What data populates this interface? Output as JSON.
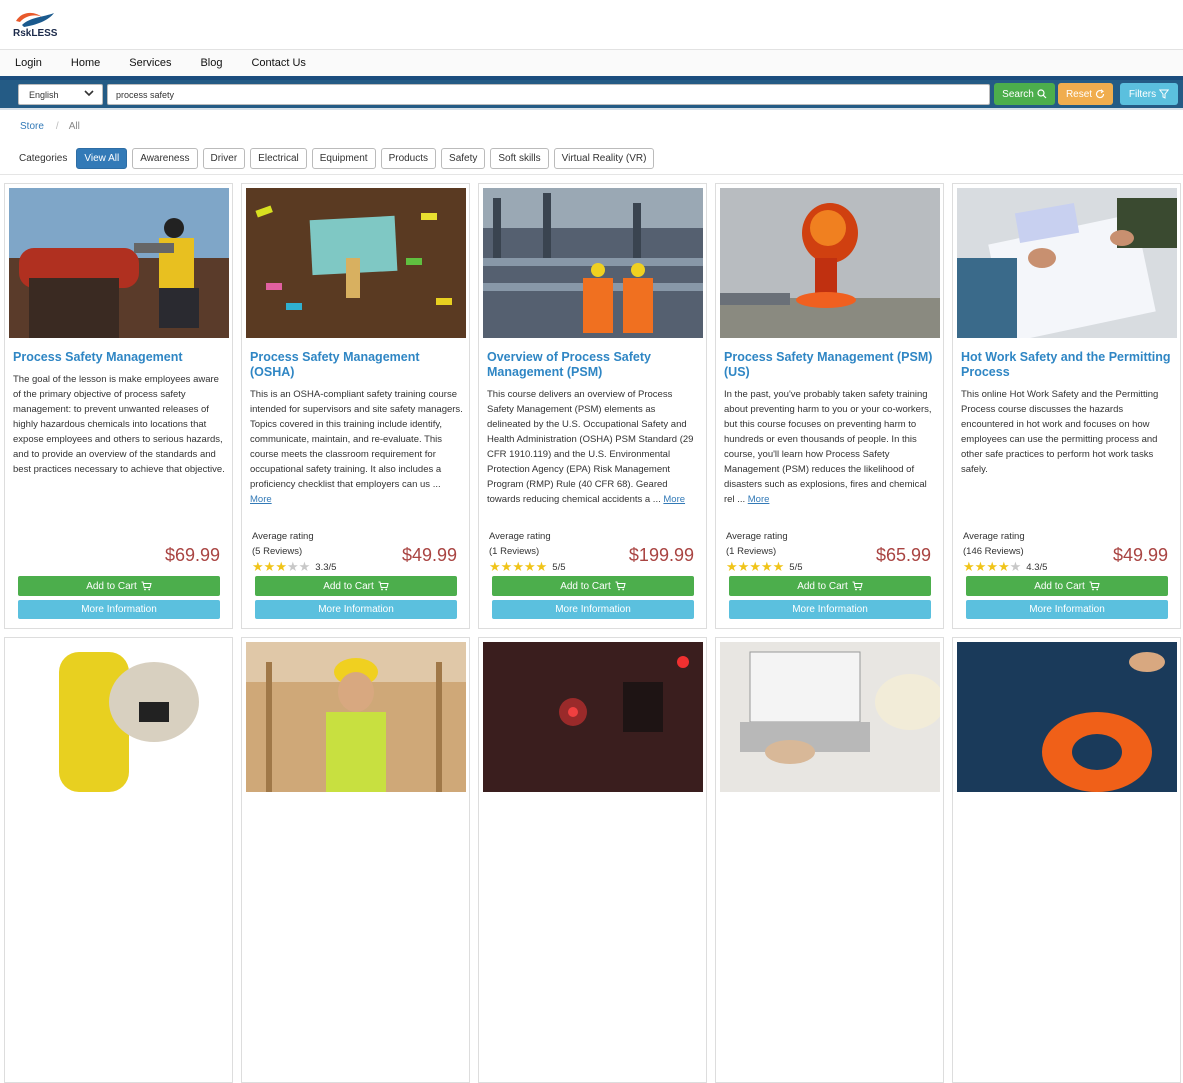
{
  "brand": {
    "name": "RskLESS"
  },
  "nav": [
    "Login",
    "Home",
    "Services",
    "Blog",
    "Contact Us"
  ],
  "search": {
    "language": "English",
    "query": "process safety",
    "search_label": "Search",
    "reset_label": "Reset",
    "filters_label": "Filters"
  },
  "breadcrumb": {
    "root": "Store",
    "current": "All"
  },
  "categories": {
    "label": "Categories",
    "items": [
      "View All",
      "Awareness",
      "Driver",
      "Electrical",
      "Equipment",
      "Products",
      "Safety",
      "Soft skills",
      "Virtual Reality (VR)"
    ],
    "active": "View All"
  },
  "labels": {
    "avg_rating": "Average rating",
    "add_to_cart": "Add to Cart",
    "more_info": "More Information",
    "more": "More"
  },
  "courses": [
    {
      "title": "Process Safety Management",
      "description": "The goal of the lesson is make employees aware of the primary objective of process safety management: to prevent unwanted releases of highly hazardous chemicals into locations that expose employees and others to serious hazards, and to provide an overview of the standards and best practices necessary to achieve that objective.",
      "price": "$69.99",
      "has_rating": false
    },
    {
      "title": "Process Safety Management (OSHA)",
      "description": "This is an OSHA-compliant safety training course intended for supervisors and site safety managers. Topics covered in this training include identify, communicate, maintain, and re-evaluate. This course meets the classroom requirement for occupational safety training. It also includes a proficiency checklist that employers can us ...",
      "price": "$49.99",
      "has_rating": true,
      "reviews": "(5 Reviews)",
      "score": "3.3/5",
      "stars": 3.3
    },
    {
      "title": "Overview of Process Safety Management (PSM)",
      "description": "This course delivers an overview of Process Safety Management (PSM) elements as delineated by the U.S. Occupational Safety and Health Administration (OSHA) PSM Standard (29 CFR 1910.119) and the U.S. Environmental Protection Agency (EPA) Risk Management Program (RMP) Rule (40 CFR 68). Geared towards reducing chemical accidents a ...",
      "price": "$199.99",
      "has_rating": true,
      "reviews": "(1 Reviews)",
      "score": "5/5",
      "stars": 5
    },
    {
      "title": "Process Safety Management (PSM) (US)",
      "description": "In the past, you've probably taken safety training about preventing harm to you or your co-workers, but this course focuses on preventing harm to hundreds or even thousands of people. In this course, you'll learn how Process Safety Management (PSM) reduces the likelihood of disasters such as explosions, fires and chemical rel ...",
      "price": "$65.99",
      "has_rating": true,
      "reviews": "(1 Reviews)",
      "score": "5/5",
      "stars": 5
    },
    {
      "title": "Hot Work Safety and the Permitting Process",
      "description": "This online Hot Work Safety and the Permitting Process course discusses the hazards encountered in hot work and focuses on how employees can use the permitting process and other safe practices to perform hot work tasks safely.",
      "price": "$49.99",
      "has_rating": true,
      "reviews": "(146 Reviews)",
      "score": "4.3/5",
      "stars": 4.3
    }
  ],
  "image_themes": [
    "industrial-worker-valve",
    "safety-first-sign",
    "refinery-workers",
    "fire-explosion",
    "paperwork-permit",
    "hazmat-suit-worker",
    "construction-worker",
    "laser-lab",
    "laptop-hardhat",
    "life-ring-water"
  ]
}
